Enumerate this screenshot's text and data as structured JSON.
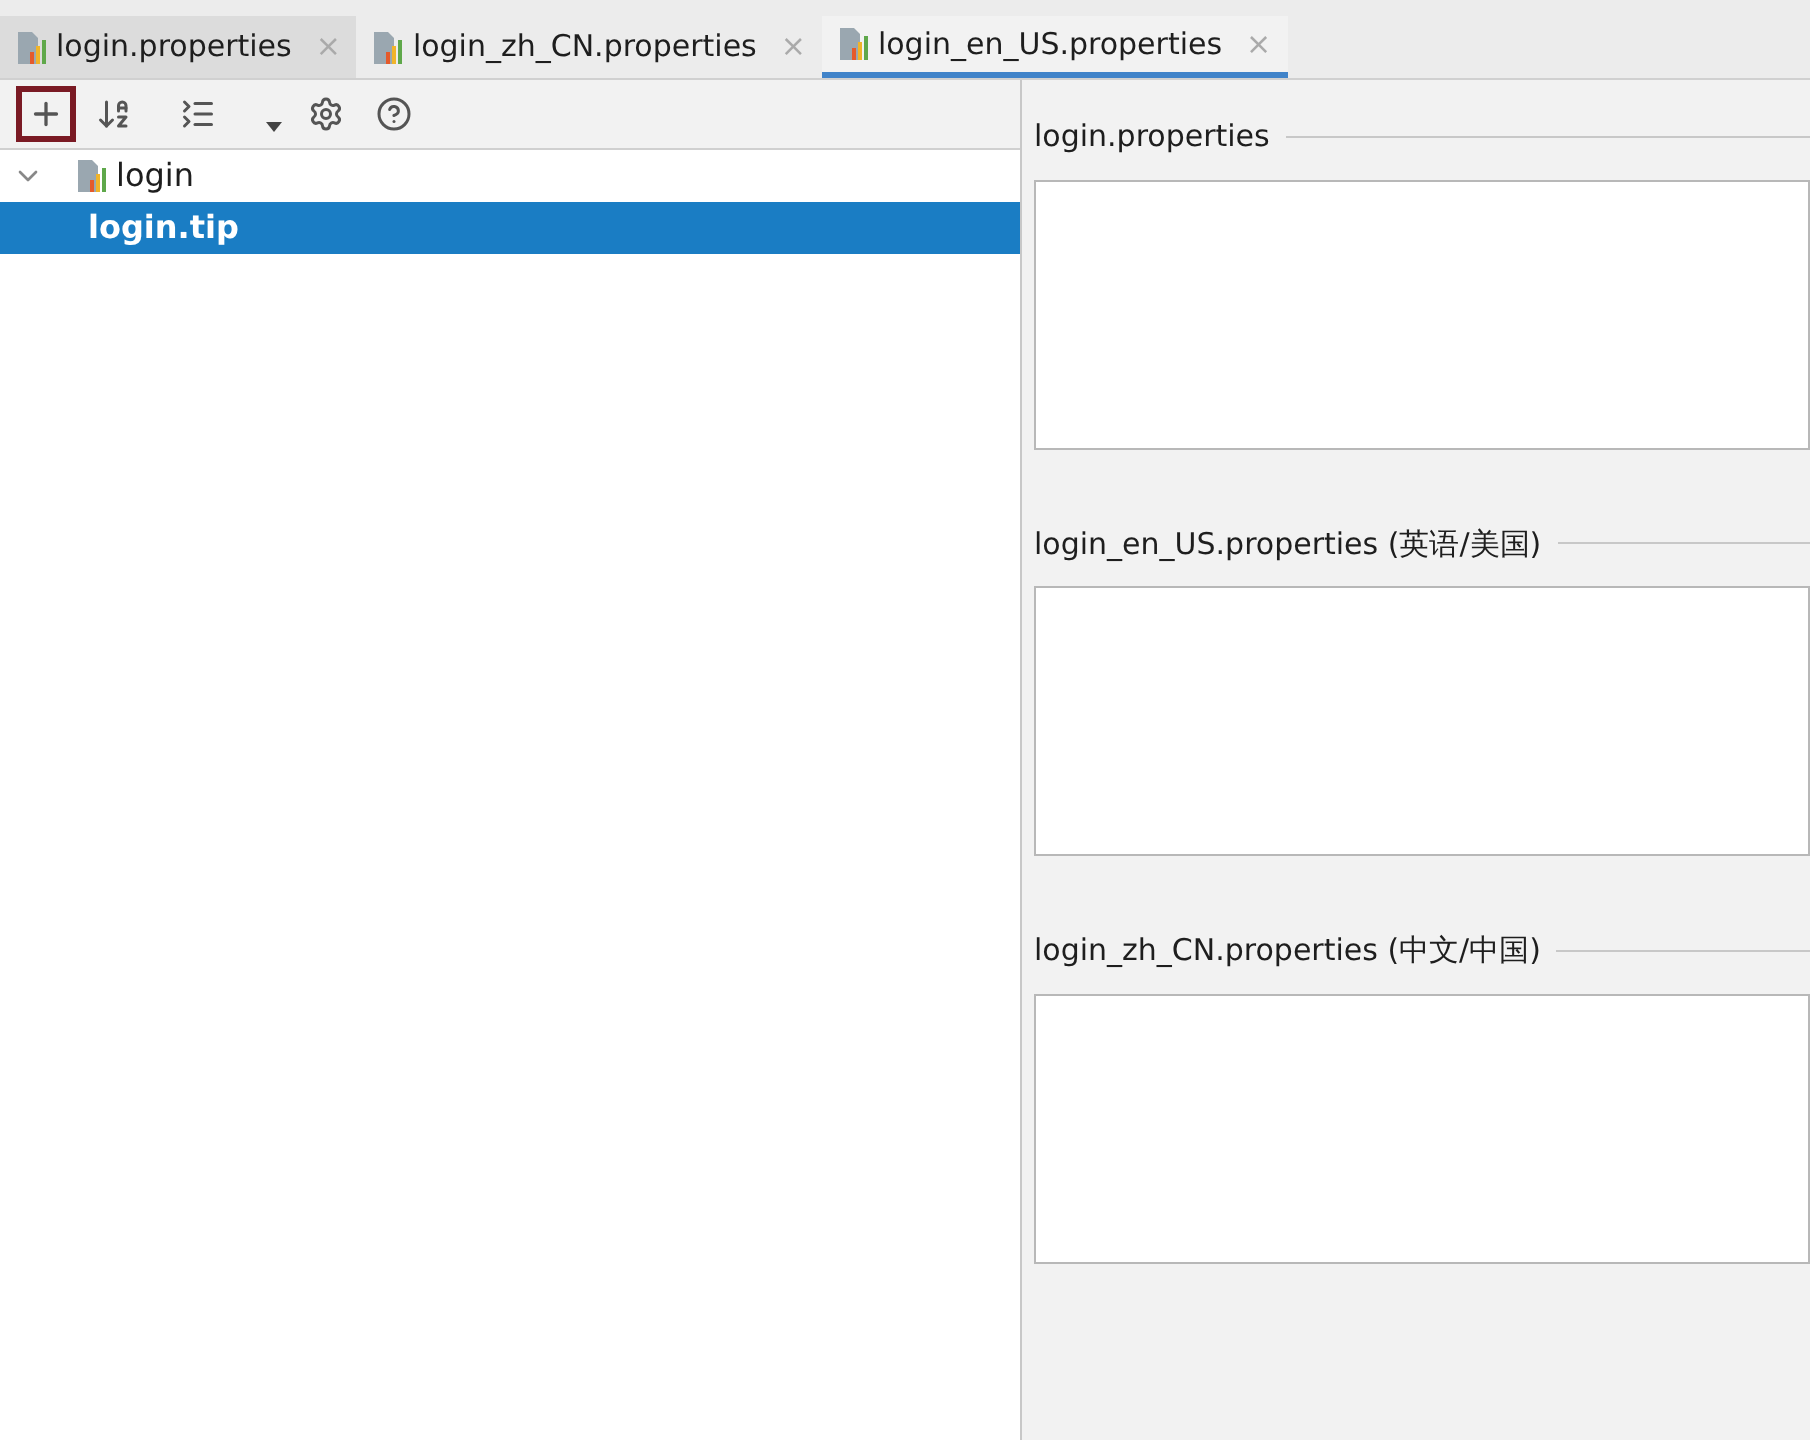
{
  "tabs": [
    {
      "label": "login.properties",
      "selected": false,
      "close": "×"
    },
    {
      "label": "login_zh_CN.properties",
      "selected": false,
      "close": "×"
    },
    {
      "label": "login_en_US.properties",
      "selected": true,
      "close": "×"
    }
  ],
  "toolbar": [
    {
      "kind": "add",
      "highlighted": true
    },
    {
      "kind": "sort",
      "highlighted": false
    },
    {
      "kind": "group",
      "highlighted": false
    },
    {
      "kind": "dropdown",
      "highlighted": false
    },
    {
      "kind": "settings",
      "highlighted": false
    },
    {
      "kind": "help",
      "highlighted": false
    }
  ],
  "tree": [
    {
      "label": "login",
      "expanded": true,
      "selected": false,
      "children": [
        {
          "label": "login.tip",
          "selected": true
        }
      ]
    }
  ],
  "sections": [
    {
      "title": "login.properties"
    },
    {
      "title": "login_en_US.properties (英语/美国)"
    },
    {
      "title": "login_zh_CN.properties (中文/中国)"
    }
  ]
}
